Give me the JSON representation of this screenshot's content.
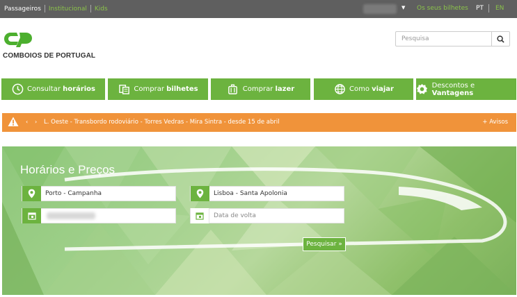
{
  "topbar": {
    "link_passageiros": "Passageiros",
    "link_institucional": "Institucional",
    "link_kids": "Kids",
    "bilhetes": "Os seus bilhetes",
    "lang_pt": "PT",
    "lang_en": "EN"
  },
  "header": {
    "logo_text": "COMBOIOS DE PORTUGAL",
    "search_placeholder": "Pesquisa"
  },
  "nav": {
    "horarios_pre": "Consultar ",
    "horarios_bold": "horários",
    "bilhetes_pre": "Comprar ",
    "bilhetes_bold": "bilhetes",
    "lazer_pre": "Comprar ",
    "lazer_bold": "lazer",
    "viajar_pre": "Como ",
    "viajar_bold": "viajar",
    "descontos_pre": "Descontos e ",
    "descontos_bold": "Vantagens"
  },
  "alert": {
    "prev": "‹",
    "next": "›",
    "message": "L. Oeste - Transbordo rodoviário - Torres Vedras - Mira Sintra - desde 15 de abril",
    "more": "+ Avisos"
  },
  "hero": {
    "title": "Horários e Preços",
    "origin": "Porto - Campanha",
    "destination": "Lisboa - Santa Apolonia",
    "return_placeholder": "Data de volta",
    "submit": "Pesquisar »"
  },
  "colors": {
    "brand_green": "#6cb33f",
    "alert_orange": "#f0933a",
    "topbar_gray": "#5f5f5f",
    "link_green": "#8bc34a"
  }
}
